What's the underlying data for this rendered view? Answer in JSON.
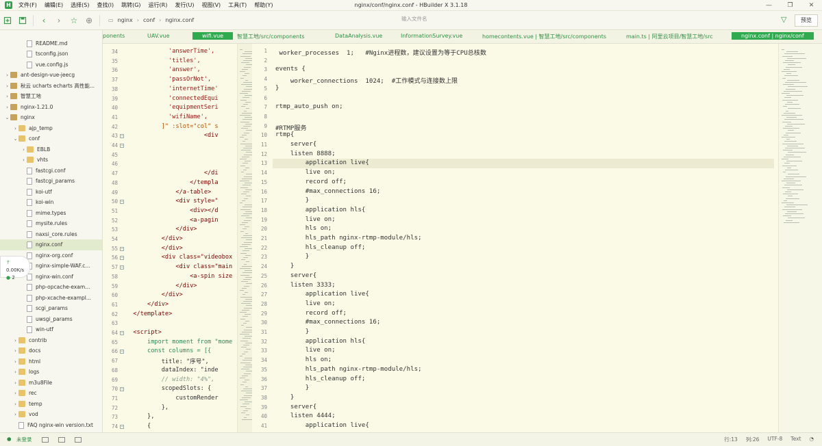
{
  "window": {
    "title": "nginx/conf/nginx.conf - HBuilder X 3.1.18",
    "logo": "H",
    "controls": [
      "—",
      "❐",
      "✕"
    ]
  },
  "menu": [
    "文件(F)",
    "编辑(E)",
    "选择(S)",
    "查找(I)",
    "跳转(G)",
    "运行(R)",
    "发行(U)",
    "视图(V)",
    "工具(T)",
    "帮助(Y)"
  ],
  "toolbar": {
    "breadcrumb": [
      "nginx",
      "conf",
      "nginx.conf"
    ],
    "search_placeholder": "输入文件名",
    "preview_label": "预览"
  },
  "sidebar": {
    "items": [
      {
        "label": "README.md",
        "type": "file",
        "indent": 2
      },
      {
        "label": "tsconfig.json",
        "type": "file",
        "indent": 2
      },
      {
        "label": "vue.config.js",
        "type": "file",
        "indent": 2
      },
      {
        "label": "ant-design-vue-jeecg",
        "type": "project",
        "indent": 0,
        "caret": "›"
      },
      {
        "label": "秋云 ucharts echarts 高性能...",
        "type": "project",
        "indent": 0,
        "caret": "›"
      },
      {
        "label": "智慧工地",
        "type": "project",
        "indent": 0,
        "caret": "›"
      },
      {
        "label": "nginx-1.21.0",
        "type": "project",
        "indent": 0,
        "caret": "›"
      },
      {
        "label": "nginx",
        "type": "project",
        "indent": 0,
        "caret": "⌄"
      },
      {
        "label": "ajp_temp",
        "type": "folder",
        "indent": 1,
        "caret": "›"
      },
      {
        "label": "conf",
        "type": "folder",
        "indent": 1,
        "caret": "⌄"
      },
      {
        "label": "EBLB",
        "type": "folder",
        "indent": 2,
        "caret": "›"
      },
      {
        "label": "vhts",
        "type": "folder",
        "indent": 2,
        "caret": "›"
      },
      {
        "label": "fastcgi.conf",
        "type": "file",
        "indent": 2
      },
      {
        "label": "fastcgi_params",
        "type": "file",
        "indent": 2
      },
      {
        "label": "koi-utf",
        "type": "file",
        "indent": 2
      },
      {
        "label": "koi-win",
        "type": "file",
        "indent": 2
      },
      {
        "label": "mime.types",
        "type": "file",
        "indent": 2
      },
      {
        "label": "mysite.rules",
        "type": "file",
        "indent": 2
      },
      {
        "label": "naxsi_core.rules",
        "type": "file",
        "indent": 2
      },
      {
        "label": "nginx.conf",
        "type": "file",
        "indent": 2,
        "selected": true
      },
      {
        "label": "nginx-org.conf",
        "type": "file",
        "indent": 2
      },
      {
        "label": "nginx-simple-WAF.c...",
        "type": "file",
        "indent": 2
      },
      {
        "label": "nginx-win.conf",
        "type": "file",
        "indent": 2
      },
      {
        "label": "php-opcache-exam...",
        "type": "file",
        "indent": 2
      },
      {
        "label": "php-xcache-exampl...",
        "type": "file",
        "indent": 2
      },
      {
        "label": "scgi_params",
        "type": "file",
        "indent": 2
      },
      {
        "label": "uwsgi_params",
        "type": "file",
        "indent": 2
      },
      {
        "label": "win-utf",
        "type": "file",
        "indent": 2
      },
      {
        "label": "contrib",
        "type": "folder",
        "indent": 1,
        "caret": "›"
      },
      {
        "label": "docs",
        "type": "folder",
        "indent": 1,
        "caret": "›"
      },
      {
        "label": "html",
        "type": "folder",
        "indent": 1,
        "caret": "›"
      },
      {
        "label": "logs",
        "type": "folder",
        "indent": 1,
        "caret": "›"
      },
      {
        "label": "m3u8File",
        "type": "folder",
        "indent": 1,
        "caret": "›"
      },
      {
        "label": "rec",
        "type": "folder",
        "indent": 1,
        "caret": "›"
      },
      {
        "label": "temp",
        "type": "folder",
        "indent": 1,
        "caret": "›"
      },
      {
        "label": "vod",
        "type": "folder",
        "indent": 1,
        "caret": "›"
      },
      {
        "label": "FAQ nginx-win version.txt",
        "type": "file",
        "indent": 1
      }
    ]
  },
  "net_widget": {
    "speed": "0.00K/s",
    "count": "2"
  },
  "left_pane": {
    "tabs": [
      {
        "label": "ponents",
        "active": false
      },
      {
        "label": "UAV.vue",
        "active": false
      },
      {
        "label": "wifi.vue",
        "active": true
      }
    ],
    "lines": [
      {
        "n": "34",
        "fold": "",
        "t": "            'answerTime',",
        "c": "str"
      },
      {
        "n": "35",
        "fold": "",
        "t": "            'titles',",
        "c": "str"
      },
      {
        "n": "36",
        "fold": "",
        "t": "            'answer',",
        "c": "str"
      },
      {
        "n": "37",
        "fold": "",
        "t": "            'passOrNot',",
        "c": "str"
      },
      {
        "n": "38",
        "fold": "",
        "t": "            'internetTime'",
        "c": "str"
      },
      {
        "n": "39",
        "fold": "",
        "t": "            'connectedEqui",
        "c": "str"
      },
      {
        "n": "40",
        "fold": "",
        "t": "            'equipmentSeri",
        "c": "str"
      },
      {
        "n": "41",
        "fold": "",
        "t": "            'wifiName',",
        "c": "str"
      },
      {
        "n": "42",
        "fold": "",
        "t": "          ]\" :slot=\"col\" s",
        "c": "attr"
      },
      {
        "n": "43",
        "fold": "⊟",
        "t": "                      <div",
        "c": "tag"
      },
      {
        "n": "44",
        "fold": "⊟",
        "t": "",
        "c": "plain"
      },
      {
        "n": "45",
        "fold": "",
        "t": "",
        "c": "plain"
      },
      {
        "n": "46",
        "fold": "",
        "t": "",
        "c": "plain"
      },
      {
        "n": "47",
        "fold": "",
        "t": "                      </di",
        "c": "tag"
      },
      {
        "n": "48",
        "fold": "",
        "t": "                  </templa",
        "c": "tag"
      },
      {
        "n": "49",
        "fold": "",
        "t": "              </a-table>",
        "c": "tag"
      },
      {
        "n": "50",
        "fold": "⊟",
        "t": "              <div style=\"",
        "c": "tag"
      },
      {
        "n": "51",
        "fold": "",
        "t": "                  <div></d",
        "c": "tag"
      },
      {
        "n": "52",
        "fold": "",
        "t": "                  <a-pagin",
        "c": "tag"
      },
      {
        "n": "53",
        "fold": "",
        "t": "              </div>",
        "c": "tag"
      },
      {
        "n": "54",
        "fold": "",
        "t": "          </div>",
        "c": "tag"
      },
      {
        "n": "55",
        "fold": "⊟",
        "t": "          </div>",
        "c": "tag"
      },
      {
        "n": "56",
        "fold": "⊟",
        "t": "          <div class=\"videobox",
        "c": "tag"
      },
      {
        "n": "57",
        "fold": "⊟",
        "t": "              <div class=\"main",
        "c": "tag"
      },
      {
        "n": "58",
        "fold": "",
        "t": "                  <a-spin size",
        "c": "tag"
      },
      {
        "n": "59",
        "fold": "",
        "t": "              </div>",
        "c": "tag"
      },
      {
        "n": "60",
        "fold": "",
        "t": "          </div>",
        "c": "tag"
      },
      {
        "n": "61",
        "fold": "",
        "t": "      </div>",
        "c": "tag"
      },
      {
        "n": "62",
        "fold": "",
        "t": "  </template>",
        "c": "tag"
      },
      {
        "n": "63",
        "fold": "",
        "t": "",
        "c": "plain"
      },
      {
        "n": "64",
        "fold": "⊟",
        "t": "  <script>",
        "c": "tag"
      },
      {
        "n": "65",
        "fold": "",
        "t": "      import moment from \"mome",
        "c": "kw"
      },
      {
        "n": "66",
        "fold": "⊟",
        "t": "      const columns = [{",
        "c": "kw"
      },
      {
        "n": "67",
        "fold": "",
        "t": "          title: \"序号\",",
        "c": "plain"
      },
      {
        "n": "68",
        "fold": "",
        "t": "          dataIndex: \"inde",
        "c": "plain"
      },
      {
        "n": "69",
        "fold": "",
        "t": "          // width: \"4%\",",
        "c": "com"
      },
      {
        "n": "70",
        "fold": "⊟",
        "t": "          scopedSlots: {",
        "c": "plain"
      },
      {
        "n": "71",
        "fold": "",
        "t": "              customRender",
        "c": "plain"
      },
      {
        "n": "72",
        "fold": "",
        "t": "          },",
        "c": "plain"
      },
      {
        "n": "73",
        "fold": "",
        "t": "      },",
        "c": "plain"
      },
      {
        "n": "74",
        "fold": "⊟",
        "t": "      {",
        "c": "plain"
      }
    ]
  },
  "right_pane": {
    "tabs": [
      {
        "label": "智慧工地/src/components",
        "active": false
      },
      {
        "label": "DataAnalysis.vue",
        "active": false
      },
      {
        "label": "InformationSurvey.vue",
        "active": false
      },
      {
        "label": "homecontents.vue | 智慧工地/src/components",
        "active": false
      },
      {
        "label": "main.ts | 阿里云项目/智慧工地/src",
        "active": false
      },
      {
        "label": "nginx.conf | nginx/conf",
        "active": true
      }
    ],
    "lines": [
      {
        "n": "1",
        "t": " worker_processes  1;   #Nginx进程数，建议设置为等于CPU总核数"
      },
      {
        "n": "2",
        "t": ""
      },
      {
        "n": "3",
        "t": "events {"
      },
      {
        "n": "4",
        "t": "    worker_connections  1024;  #工作模式与连接数上限"
      },
      {
        "n": "5",
        "t": "}"
      },
      {
        "n": "6",
        "t": ""
      },
      {
        "n": "7",
        "t": "rtmp_auto_push on;"
      },
      {
        "n": "8",
        "t": ""
      },
      {
        "n": "9",
        "t": "#RTMP服务"
      },
      {
        "n": "10",
        "t": "rtmp{"
      },
      {
        "n": "11",
        "t": "    server{"
      },
      {
        "n": "12",
        "t": "    listen 8888;"
      },
      {
        "n": "13",
        "t": "        application live{"
      },
      {
        "n": "14",
        "t": "        live on;"
      },
      {
        "n": "15",
        "t": "        record off;"
      },
      {
        "n": "16",
        "t": "        #max_connections 16;"
      },
      {
        "n": "17",
        "t": "        }"
      },
      {
        "n": "18",
        "t": "        application hls{"
      },
      {
        "n": "19",
        "t": "        live on;"
      },
      {
        "n": "20",
        "t": "        hls on;"
      },
      {
        "n": "21",
        "t": "        hls_path nginx-rtmp-module/hls;"
      },
      {
        "n": "22",
        "t": "        hls_cleanup off;"
      },
      {
        "n": "23",
        "t": "        }"
      },
      {
        "n": "24",
        "t": "    }"
      },
      {
        "n": "25",
        "t": "    server{"
      },
      {
        "n": "26",
        "t": "    listen 3333;"
      },
      {
        "n": "27",
        "t": "        application live{"
      },
      {
        "n": "28",
        "t": "        live on;"
      },
      {
        "n": "29",
        "t": "        record off;"
      },
      {
        "n": "30",
        "t": "        #max_connections 16;"
      },
      {
        "n": "31",
        "t": "        }"
      },
      {
        "n": "32",
        "t": "        application hls{"
      },
      {
        "n": "33",
        "t": "        live on;"
      },
      {
        "n": "34",
        "t": "        hls on;"
      },
      {
        "n": "35",
        "t": "        hls_path nginx-rtmp-module/hls;"
      },
      {
        "n": "36",
        "t": "        hls_cleanup off;"
      },
      {
        "n": "37",
        "t": "        }"
      },
      {
        "n": "38",
        "t": "    }"
      },
      {
        "n": "39",
        "t": "    server{"
      },
      {
        "n": "40",
        "t": "    listen 4444;"
      },
      {
        "n": "41",
        "t": "        application live{"
      }
    ]
  },
  "statusbar": {
    "login": "未登录",
    "cursor": "行:13",
    "column": "列:26",
    "encoding": "UTF-8",
    "syntax": "Text"
  },
  "colors": {
    "accent": "#2faa4f",
    "background": "#fafae6"
  }
}
